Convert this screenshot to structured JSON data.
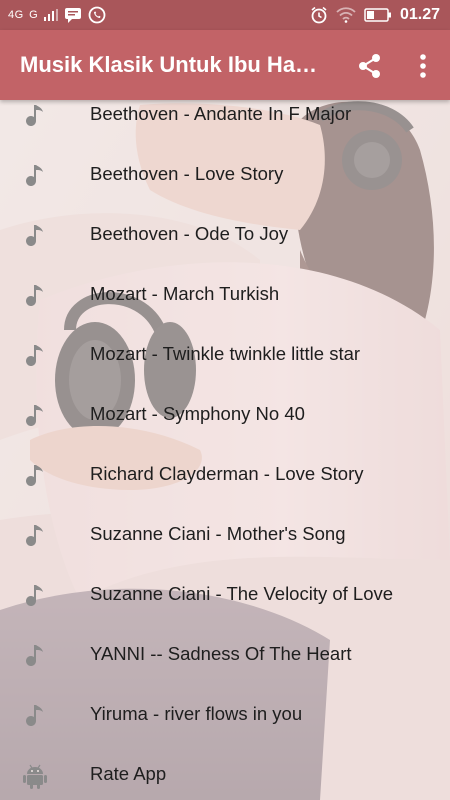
{
  "status_bar": {
    "network": "4G  G",
    "time": "01.27"
  },
  "app_bar": {
    "title": "Musik Klasik Untuk Ibu Ha…"
  },
  "songs": [
    {
      "label": "Beethoven - Andante In F Major"
    },
    {
      "label": "Beethoven - Love Story"
    },
    {
      "label": "Beethoven - Ode To Joy"
    },
    {
      "label": "Mozart - March Turkish"
    },
    {
      "label": "Mozart - Twinkle twinkle little star"
    },
    {
      "label": "Mozart - Symphony No 40"
    },
    {
      "label": "Richard Clayderman - Love Story"
    },
    {
      "label": "Suzanne Ciani - Mother's Song"
    },
    {
      "label": "Suzanne Ciani - The Velocity of Love"
    },
    {
      "label": "YANNI -- Sadness Of The Heart"
    },
    {
      "label": "Yiruma - river flows in you"
    }
  ],
  "rate_app": {
    "label": "Rate App"
  },
  "icons": {
    "song": "music-note-icon",
    "rate": "android-icon",
    "share": "share-icon",
    "more": "more-vert-icon"
  },
  "colors": {
    "status_bar": "#a9565a",
    "app_bar": "#c26367",
    "text": "#1e1e1e"
  }
}
